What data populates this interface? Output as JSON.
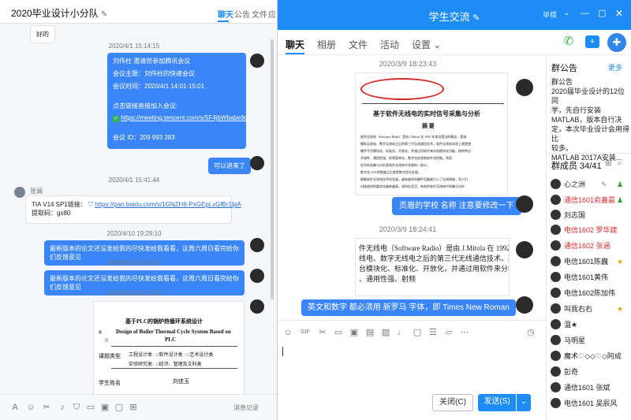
{
  "left": {
    "title": "2020毕业设计小分队",
    "tabs": [
      "聊天",
      "公告",
      "文件",
      "应"
    ],
    "msg1": "好的",
    "ts1": "2020/4/1 15:14:15",
    "meeting": {
      "l1": "刘伟柱 邀请您参加腾讯会议",
      "l2": "会议主题：刘伟柱的快速会议",
      "l3": "会议时间：2020/4/1 14:01-15:01",
      "l4": "点击链接直接加入会议:",
      "link": "https://meeting.tencent.com/s/5F4jbWbabe9dd",
      "id": "会议 ID：209 993 283"
    },
    "msg2": "可以进来了",
    "ts2": "2020/4/1 15:41:44",
    "sender": "张谰",
    "pan_label": "TIA V14 SP1链接：",
    "pan_link": "https://pan.baidu.com/s/1GNZH6-PxGEpLvGfBr1lpA",
    "pan_code": "提取码：gx80",
    "ts3": "2020/4/10 19:29:10",
    "notice1": "最新版本的论文还没发给我的尽快发给我看看，这周六周日看完给你们反馈意见",
    "ts4": "2020/4/18 11:24:24",
    "notice2": "最新版本的论文还没发给我的尽快发给我看看，这周六周日看完给你们反馈意见",
    "ts5": "2020/4/18 15:41:35",
    "doc": {
      "title": "基于PLC的锅炉热循环系统设计",
      "en1": "Design of Boiler Thermal Cycle System Based on",
      "en2": "PLC",
      "r1": "题",
      "r1b": "目",
      "r2": "课题类型",
      "r3": "学生姓名",
      "opt1": "工程设计类  ·  □软件设计类  ·  □艺术设计类",
      "opt2": "实验研究类  ·  □经济、管理及文科类",
      "name": "刘佳玉"
    },
    "toolbar": {
      "history": "消息记录"
    }
  },
  "right": {
    "title": "学生交流",
    "tabs": [
      "聊天",
      "相册",
      "文件",
      "活动",
      "设置"
    ],
    "ts1": "2020/3/9 18:23:43",
    "paper": {
      "title": "基于软件无线电的实时信号采集与分析",
      "abstract": "摘    要",
      "body": [
        "软件无线电（Software Radio）是由 J.Mitola 在 1992 年首次提出的概念，是继",
        "模拟无线电、数字无线电之后的第三代无线通信技术。软件无线电本质上就是使",
        "硬件平台模块化、标准化、开放化，并通过用软件来实现模块化功能，结构特点",
        "开放性、通用性强，射频宽带化，数字化处理和软件化控制。然而",
        "信号的采集与分析是软件无线电中关键的一部分，",
        "数字化 A/D 转换器之后就是数字信号处理。",
        "随着软件无线电技术的发展，越来越多的硬件设备被引入了无线网络，而人们",
        "对接收机的要求也越来越高，如何在灵活、有效的软件无线电中采集与分析"
      ]
    },
    "msg1": "页眉的学校 名称 注意要修改一下",
    "ts2": "2020/3/9 18:24:41",
    "excerpt": [
      "件无线电（Software Radio）是由 J.Mitola 在 1992 年提出来",
      "线电、数字无线电之后的第三代无线通信技术。软件无",
      "台模块化、标准化、开放化，并通过用软件来分模块化",
      "、通用性强、射频"
    ],
    "msg2": "英文和数字 都必须用  新罗马 字体，即 Times New Roman",
    "close_btn": "关闭(C)",
    "send_btn": "发送(S)",
    "announce": {
      "header": "群公告",
      "more": "更多",
      "title": "群公告",
      "l1": "2020届毕业设计的12位同",
      "l2": "学，先自行安装",
      "l3": "MATLAB，版本自行决",
      "l4": "定，本次毕业设计会用得比",
      "l5": "较多。",
      "l6": "MATLAB 2017A安装..."
    },
    "members_header": "群成员 34/41",
    "members": [
      "心之洲",
      "通信1601俞嘉晨",
      "刘志国",
      "电信1602 罗华建",
      "通信1602 张涵",
      "电信1601陈巍",
      "电信1601黄伟",
      "电信1602陈加伟",
      "叫我右右",
      "温★",
      "马明星",
      "魔术♡◇◇♡◇阿成",
      "彭奇",
      "通信1601 张斌",
      "电信1601 吴辰风"
    ],
    "colors": {
      "accent": "#1e8cf5",
      "bubble": "#3a86f8",
      "red_name": "#d62b2b"
    }
  }
}
